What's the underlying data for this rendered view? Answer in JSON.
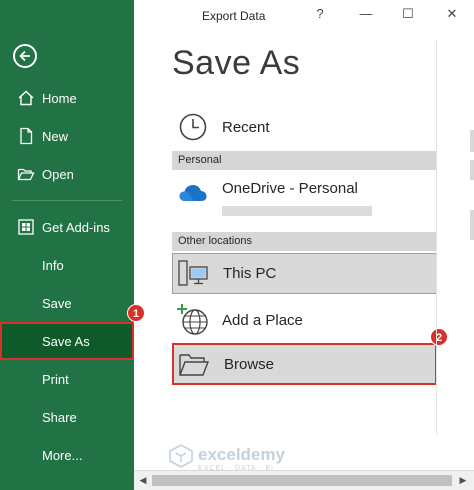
{
  "sidebar": {
    "items": [
      {
        "label": "Home"
      },
      {
        "label": "New"
      },
      {
        "label": "Open"
      },
      {
        "label": "Get Add-ins"
      },
      {
        "label": "Info"
      },
      {
        "label": "Save"
      },
      {
        "label": "Save As"
      },
      {
        "label": "Print"
      },
      {
        "label": "Share"
      },
      {
        "label": "More..."
      }
    ],
    "selected": "Save As",
    "colors": {
      "background": "#217346",
      "selected_bg": "#0f5a2b",
      "highlight": "#d9302a"
    }
  },
  "window": {
    "title": "Export Data",
    "help_glyph": "?",
    "minimize_glyph": "—",
    "maximize_glyph": "☐",
    "close_glyph": "✕"
  },
  "main": {
    "title": "Save As",
    "recent_label": "Recent",
    "personal_header": "Personal",
    "onedrive_label": "OneDrive - Personal",
    "other_header": "Other locations",
    "this_pc_label": "This PC",
    "add_place_label": "Add a Place",
    "browse_label": "Browse"
  },
  "badges": {
    "one": "1",
    "two": "2"
  },
  "watermark": {
    "name": "exceldemy",
    "tagline": "EXCEL · DATA · BI"
  },
  "scrollbar": {
    "left_arrow": "◀",
    "right_arrow": "▶"
  }
}
